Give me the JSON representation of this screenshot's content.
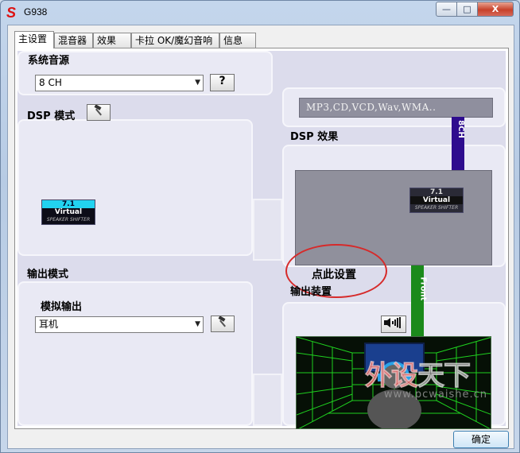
{
  "window": {
    "title": "G938",
    "logo_letter": "S",
    "minimize_label": "—",
    "maximize_label": "□",
    "close_label": "X"
  },
  "tabs": [
    {
      "label": "主设置",
      "active": true
    },
    {
      "label": "混音器",
      "active": false
    },
    {
      "label": "效果",
      "active": false
    },
    {
      "label": "卡拉 OK/魔幻音响",
      "active": false
    },
    {
      "label": "信息",
      "active": false
    }
  ],
  "system_source": {
    "heading": "系统音源",
    "channel_select": "8 CH",
    "help_button": "?",
    "formats": "MP3,CD,VCD,Wav,WMA.."
  },
  "signal_labels": {
    "top": "8CH",
    "bottom": "Front"
  },
  "dsp_mode": {
    "heading": "DSP 模式",
    "badge": {
      "line1": "7.1",
      "line2": "Virtual",
      "line3": "SPEAKER SHIFTER"
    }
  },
  "dsp_effect": {
    "heading": "DSP 效果",
    "badge": {
      "line1": "7.1",
      "line2": "Virtual",
      "line3": "SPEAKER SHIFTER"
    }
  },
  "callout": {
    "text": "点此设置",
    "color": "#d62a2a"
  },
  "output_mode": {
    "heading": "输出模式",
    "sub_heading": "模拟输出",
    "select_value": "耳机"
  },
  "output_device": {
    "heading": "输出装置"
  },
  "footer": {
    "ok_button": "确定"
  },
  "watermark": {
    "text_red": "外设",
    "text_gray": "天下",
    "url": "www.pcwaishe.cn"
  },
  "colors": {
    "panel_bg": "#e9e9f4",
    "screen_gray": "#90909c",
    "bar_purple": "#2e0d8e",
    "bar_green": "#1b8a1b",
    "grid_green": "#1fd11f",
    "badge_cyan": "#22d3f0"
  },
  "icons": {
    "tool": "hammer-icon",
    "speaker": "speaker-volume-icon",
    "help": "question-mark-icon"
  }
}
